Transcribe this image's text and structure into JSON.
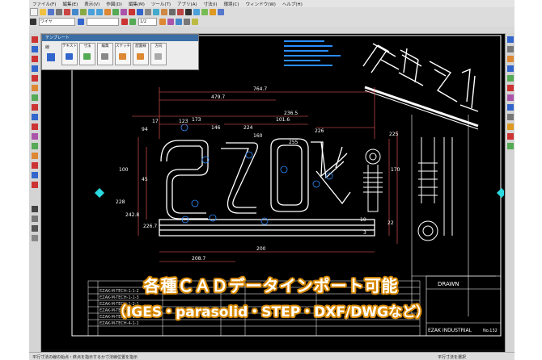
{
  "menu": [
    "ファイル(F)",
    "編集(E)",
    "表示(V)",
    "作図(D)",
    "編集(M)",
    "ツール(T)",
    "アプリ(A)",
    "寸法(I)",
    "環境(C)",
    "ウィンドウ(W)",
    "ヘルプ(H)"
  ],
  "toolbar": {
    "mode_select": "ワイヤ",
    "layer_select": "",
    "scale_select": "1/2"
  },
  "dialog": {
    "title": "テンプレート",
    "label": "線",
    "buttons": [
      "テキスト",
      "寸法",
      "編集",
      "スケッチ",
      "配置線",
      "方向"
    ]
  },
  "canvas": {
    "dimensions": [
      "764.7",
      "479.7",
      "123",
      "17",
      "173",
      "146",
      "224",
      "160",
      "101.6",
      "100",
      "45",
      "226",
      "255",
      "225",
      "170",
      "228",
      "242.8",
      "226.7",
      "22",
      "10",
      "3",
      "94",
      "200",
      "208.7",
      "236.5"
    ],
    "title_block": {
      "company": "EZAK INDUSTRIAL",
      "rows": [
        "EZAK-M-TECH-1-1-2",
        "EZAK-M-TECH-1-1-3",
        "EZAK-M-TECH-1-2-1",
        "EZAK-M-TECH-2-1-1",
        "EZAK-M-TECH-3-1-1",
        "EZAK-M-TECH-4-1-1"
      ],
      "no_label": "No.132",
      "drawn_label": "DRAWN"
    }
  },
  "caption": {
    "line1": "各種ＣＡＤデータインポート可能",
    "line2": "（IGES・parasolid・STEP・DXF/DWGなど）"
  },
  "statusbar": {
    "left": "平行寸法の線の始点・終点を指示するか寸法線位置を指示",
    "right": "平行寸法を選択"
  }
}
